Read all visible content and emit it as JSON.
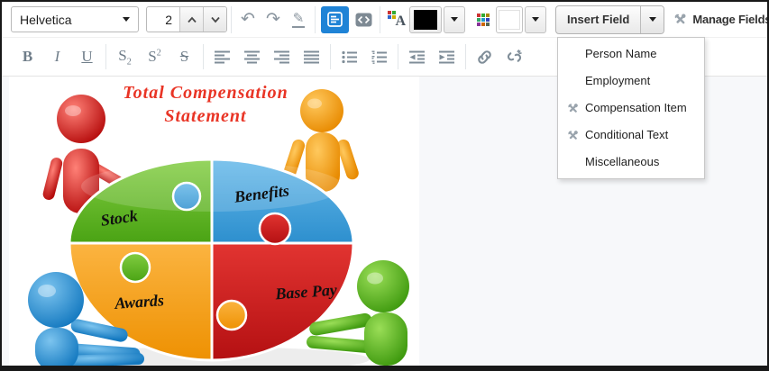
{
  "toolbar": {
    "font_name": "Helvetica",
    "font_size": "2",
    "bold": "B",
    "italic": "I",
    "underline": "U",
    "sub_base": "S",
    "sub_mark": "2",
    "sup_base": "S",
    "sup_mark": "2",
    "strike": "S",
    "font_color_letter": "A",
    "current_text_color": "#000000",
    "current_highlight_color": "#ffffff",
    "insert_field_label": "Insert Field",
    "manage_fields_label": "Manage Fields"
  },
  "icons": {
    "undo": "↶",
    "redo": "↷",
    "eraser": "✎"
  },
  "insert_field_menu": {
    "items": [
      {
        "label": "Person Name",
        "has_icon": false
      },
      {
        "label": "Employment",
        "has_icon": false
      },
      {
        "label": "Compensation Item",
        "has_icon": true
      },
      {
        "label": "Conditional Text",
        "has_icon": true
      },
      {
        "label": "Miscellaneous",
        "has_icon": false
      }
    ]
  },
  "editor_image": {
    "title_line1": "Total Compensation",
    "title_line2": "Statement",
    "title_color": "#e93425",
    "segments": [
      {
        "label": "Stock",
        "color": "#5bb32a"
      },
      {
        "label": "Benefits",
        "color": "#3da0dc"
      },
      {
        "label": "Awards",
        "color": "#f6a216"
      },
      {
        "label": "Base Pay",
        "color": "#cd1a1c"
      }
    ],
    "figure_colors": [
      "#cf1d1d",
      "#f59d13",
      "#2f97dd",
      "#54b822"
    ]
  }
}
